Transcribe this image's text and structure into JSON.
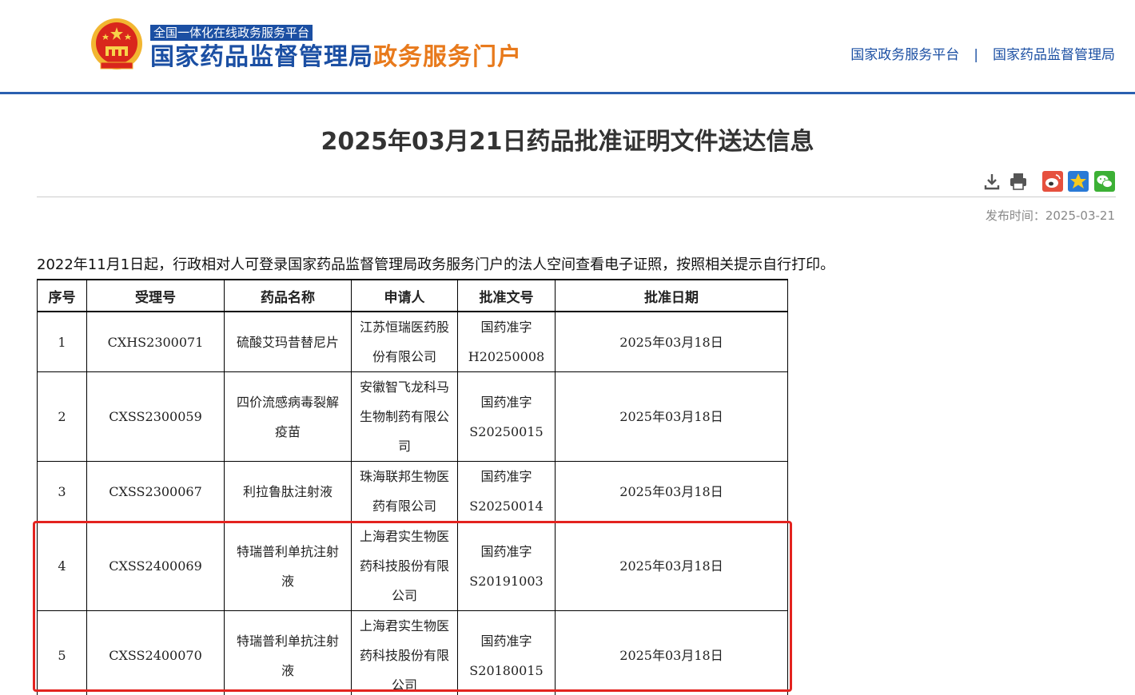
{
  "header": {
    "platform_badge": "全国一体化在线政务服务平台",
    "logo_title_blue": "国家药品监督管理局",
    "logo_title_orange": "政务服务门户",
    "links": [
      "国家政务服务平台",
      "国家药品监督管理局"
    ],
    "link_separator": "|"
  },
  "article": {
    "title": "2025年03月21日药品批准证明文件送达信息",
    "publish_time": "发布时间：2025-03-21",
    "intro": "2022年11月1日起，行政相对人可登录国家药品监督管理局政务服务门户的法人空间查看电子证照，按照相关提示自行打印。"
  },
  "tools": [
    "download-icon",
    "print-icon",
    "weibo-icon",
    "qzone-icon",
    "wechat-icon"
  ],
  "colors": {
    "brand_blue": "#1b4fa3",
    "brand_orange": "#e87a1c",
    "highlight_red": "#e3231f"
  },
  "table": {
    "headers": [
      "序号",
      "受理号",
      "药品名称",
      "申请人",
      "批准文号",
      "批准日期"
    ],
    "rows": [
      [
        "1",
        "CXHS2300071",
        "硫酸艾玛昔替尼片",
        "江苏恒瑞医药股份有限公司",
        "国药准字H20250008",
        "2025年03月18日"
      ],
      [
        "2",
        "CXSS2300059",
        "四价流感病毒裂解疫苗",
        "安徽智飞龙科马生物制药有限公司",
        "国药准字S20250015",
        "2025年03月18日"
      ],
      [
        "3",
        "CXSS2300067",
        "利拉鲁肽注射液",
        "珠海联邦生物医药有限公司",
        "国药准字S20250014",
        "2025年03月18日"
      ],
      [
        "4",
        "CXSS2400069",
        "特瑞普利单抗注射液",
        "上海君实生物医药科技股份有限公司",
        "国药准字S20191003",
        "2025年03月18日"
      ],
      [
        "5",
        "CXSS2400070",
        "特瑞普利单抗注射液",
        "上海君实生物医药科技股份有限公司",
        "国药准字S20180015",
        "2025年03月18日"
      ]
    ]
  }
}
